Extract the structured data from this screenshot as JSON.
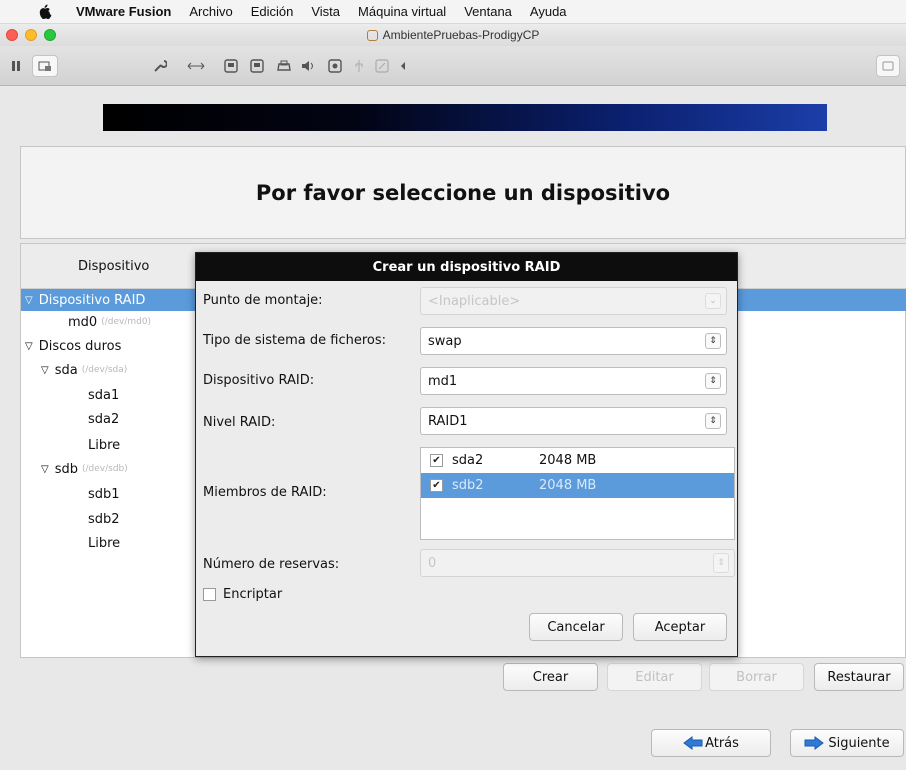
{
  "menubar": {
    "app_name": "VMware Fusion",
    "items": [
      "Archivo",
      "Edición",
      "Vista",
      "Máquina virtual",
      "Ventana",
      "Ayuda"
    ]
  },
  "window": {
    "title": "AmbientePruebas-ProdigyCP"
  },
  "installer": {
    "heading": "Por favor seleccione un dispositivo",
    "column_header": "Dispositivo",
    "tree": [
      {
        "label": "Dispositivo RAID",
        "sub": "",
        "expanded": true,
        "selected": true
      },
      {
        "label": "md0",
        "sub": "(/dev/md0)"
      },
      {
        "label": "Discos duros",
        "sub": "",
        "expanded": true
      },
      {
        "label": "sda",
        "sub": "(/dev/sda)",
        "expanded": true
      },
      {
        "label": "sda1",
        "sub": ""
      },
      {
        "label": "sda2",
        "sub": ""
      },
      {
        "label": "Libre",
        "sub": ""
      },
      {
        "label": "sdb",
        "sub": "(/dev/sdb)",
        "expanded": true
      },
      {
        "label": "sdb1",
        "sub": ""
      },
      {
        "label": "sdb2",
        "sub": ""
      },
      {
        "label": "Libre",
        "sub": ""
      }
    ],
    "buttons": {
      "crear": "Crear",
      "editar": "Editar",
      "borrar": "Borrar",
      "restaurar": "Restaurar"
    },
    "nav": {
      "back": "Atrás",
      "next": "Siguiente"
    }
  },
  "dialog": {
    "title": "Crear un dispositivo RAID",
    "mount_label": "Punto de montaje:",
    "mount_value": "<Inaplicable>",
    "fs_label": "Tipo de sistema de ficheros:",
    "fs_value": "swap",
    "raid_device_label": "Dispositivo RAID:",
    "raid_device_value": "md1",
    "raid_level_label": "Nivel RAID:",
    "raid_level_value": "RAID1",
    "members_label": "Miembros de RAID:",
    "members": [
      {
        "name": "sda2",
        "size": "2048 MB",
        "checked": true,
        "selected": false
      },
      {
        "name": "sdb2",
        "size": "2048 MB",
        "checked": true,
        "selected": true
      }
    ],
    "spares_label": "Número de reservas:",
    "spares_value": "0",
    "encrypt_label": "Encriptar",
    "encrypt_checked": false,
    "cancel": "Cancelar",
    "accept": "Aceptar"
  },
  "colors": {
    "selection": "#5b9bdc",
    "dialog_title_bg": "#0d0d0d"
  }
}
